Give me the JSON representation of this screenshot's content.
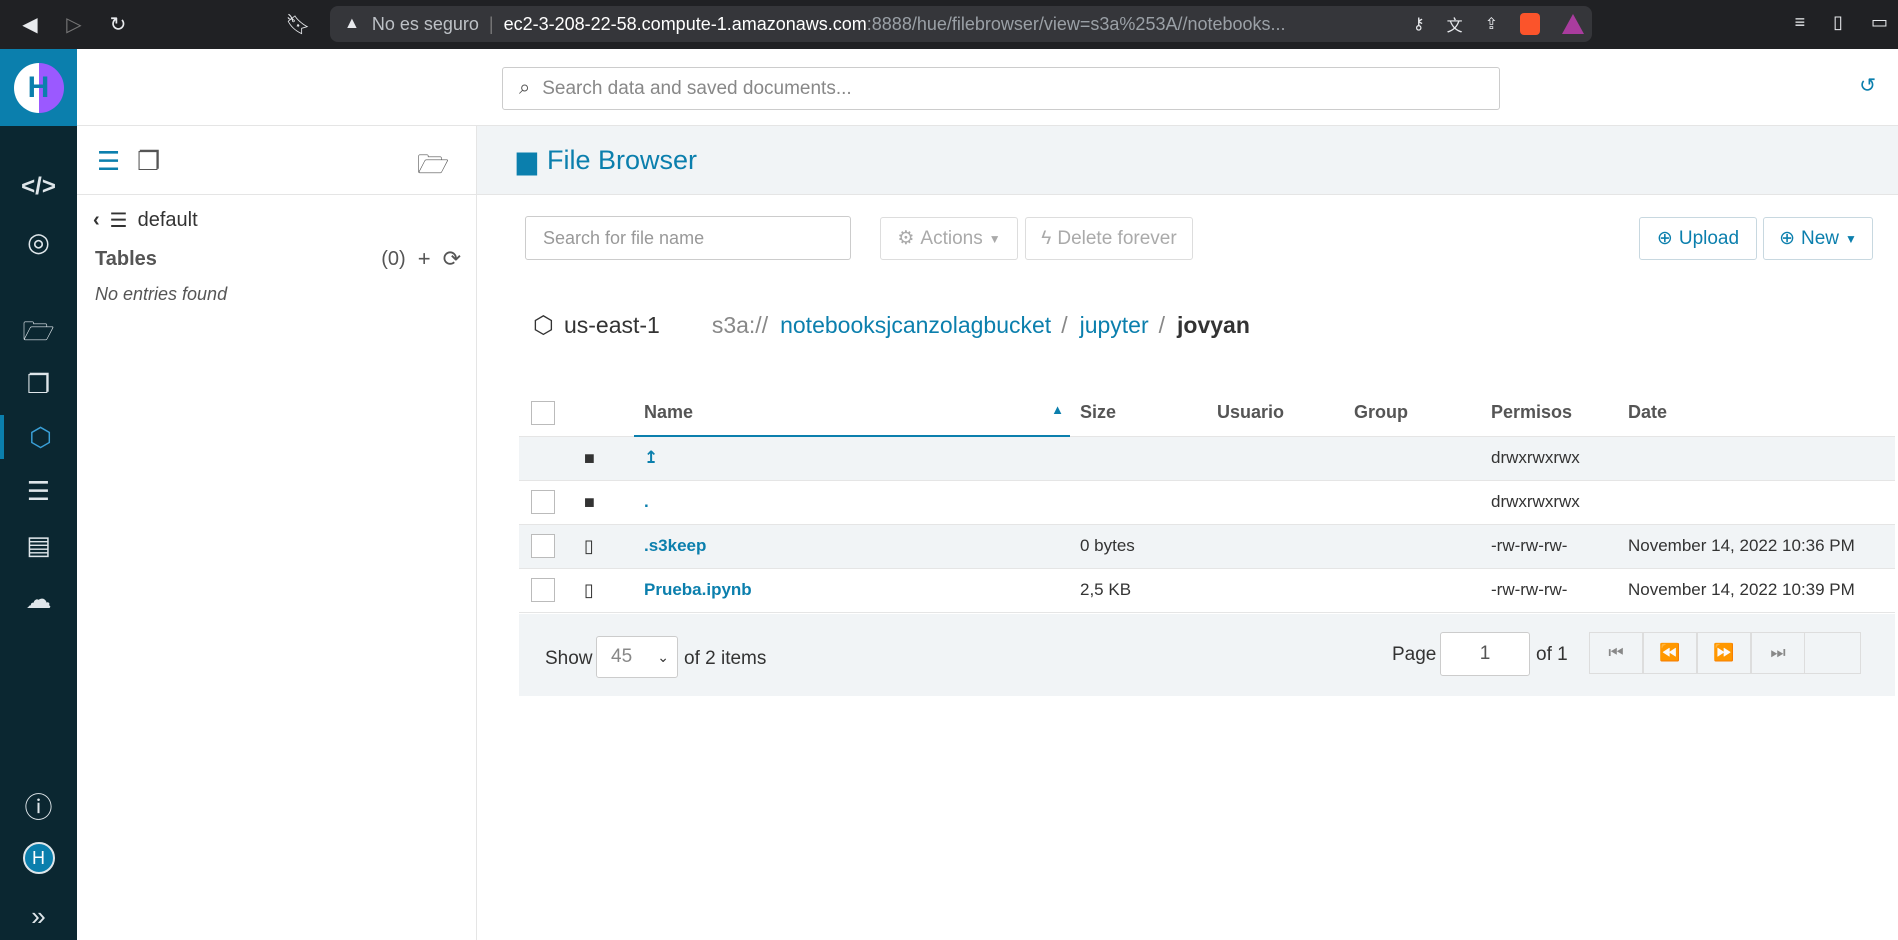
{
  "browser": {
    "insecure_label": "No es seguro",
    "url_host": "ec2-3-208-22-58.compute-1.amazonaws.com",
    "url_rest": ":8888/hue/filebrowser/view=s3a%253A//notebooks..."
  },
  "header": {
    "search_placeholder": "Search data and saved documents..."
  },
  "assist": {
    "database": "default",
    "tables_label": "Tables",
    "tables_count": "(0)",
    "empty_text": "No entries found"
  },
  "page": {
    "title": "File Browser"
  },
  "toolbar": {
    "file_search_placeholder": "Search for file name",
    "actions_label": "Actions",
    "delete_label": "Delete forever",
    "upload_label": "Upload",
    "new_label": "New"
  },
  "breadcrumb": {
    "region": "us-east-1",
    "scheme": "s3a://",
    "bucket": "notebooksjcanzolagbucket",
    "folder": "jupyter",
    "current": "jovyan"
  },
  "table": {
    "headers": {
      "name": "Name",
      "size": "Size",
      "user": "Usuario",
      "group": "Group",
      "perms": "Permisos",
      "date": "Date"
    },
    "rows": [
      {
        "name": "↥",
        "type": "folder",
        "size": "",
        "user": "",
        "group": "",
        "perms": "drwxrwxrwx",
        "date": ""
      },
      {
        "name": ".",
        "type": "folder",
        "size": "",
        "user": "",
        "group": "",
        "perms": "drwxrwxrwx",
        "date": ""
      },
      {
        "name": ".s3keep",
        "type": "file",
        "size": "0 bytes",
        "user": "",
        "group": "",
        "perms": "-rw-rw-rw-",
        "date": "November 14, 2022 10:36 PM"
      },
      {
        "name": "Prueba.ipynb",
        "type": "file",
        "size": "2,5 KB",
        "user": "",
        "group": "",
        "perms": "-rw-rw-rw-",
        "date": "November 14, 2022 10:39 PM"
      }
    ]
  },
  "pager": {
    "show_label": "Show",
    "page_size": "45",
    "of_items": "of 2 items",
    "page_label": "Page",
    "page_value": "1",
    "of_pages": "of 1"
  },
  "user": {
    "avatar_initial": "H"
  },
  "colors": {
    "accent": "#0b7fad",
    "nav_bg": "#0b2731",
    "panel_bg": "#f1f4f6"
  }
}
